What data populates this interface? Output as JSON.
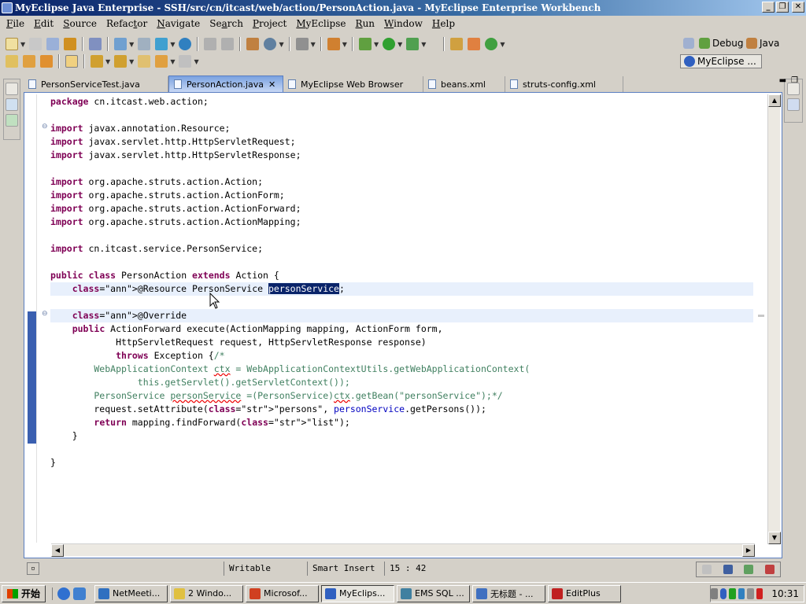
{
  "window": {
    "title": "MyEclipse Java Enterprise - SSH/src/cn/itcast/web/action/PersonAction.java - MyEclipse Enterprise Workbench"
  },
  "menu": [
    {
      "label": "File",
      "key": "F"
    },
    {
      "label": "Edit",
      "key": "E"
    },
    {
      "label": "Source",
      "key": "S"
    },
    {
      "label": "Refactor",
      "key": "t"
    },
    {
      "label": "Navigate",
      "key": "N"
    },
    {
      "label": "Search",
      "key": "a"
    },
    {
      "label": "Project",
      "key": "P"
    },
    {
      "label": "MyEclipse",
      "key": "M"
    },
    {
      "label": "Run",
      "key": "R"
    },
    {
      "label": "Window",
      "key": "W"
    },
    {
      "label": "Help",
      "key": "H"
    }
  ],
  "perspectives": {
    "debug": "Debug",
    "java": "Java",
    "myeclipse": "MyEclipse ..."
  },
  "tabs": [
    {
      "label": "PersonServiceTest.java",
      "icon": "java-file-icon"
    },
    {
      "label": "PersonAction.java",
      "icon": "java-file-icon",
      "active": true
    },
    {
      "label": "MyEclipse Web Browser",
      "icon": "globe-icon"
    },
    {
      "label": "beans.xml",
      "icon": "xml-file-icon"
    },
    {
      "label": "struts-config.xml",
      "icon": "xml-file-icon"
    }
  ],
  "code_lines": [
    "package cn.itcast.web.action;",
    "",
    "import javax.annotation.Resource;",
    "import javax.servlet.http.HttpServletRequest;",
    "import javax.servlet.http.HttpServletResponse;",
    "",
    "import org.apache.struts.action.Action;",
    "import org.apache.struts.action.ActionForm;",
    "import org.apache.struts.action.ActionForward;",
    "import org.apache.struts.action.ActionMapping;",
    "",
    "import cn.itcast.service.PersonService;",
    "",
    "public class PersonAction extends Action {",
    "    @Resource PersonService personService;",
    "",
    "    @Override",
    "    public ActionForward execute(ActionMapping mapping, ActionForm form,",
    "            HttpServletRequest request, HttpServletResponse response)",
    "            throws Exception {/*",
    "        WebApplicationContext ctx = WebApplicationContextUtils.getWebApplicationContext(",
    "                this.getServlet().getServletContext());",
    "        PersonService personService =(PersonService)ctx.getBean(\"personService\");*/",
    "        request.setAttribute(\"persons\", personService.getPersons());",
    "        return mapping.findForward(\"list\");",
    "    }",
    "",
    "}"
  ],
  "status": {
    "writable": "Writable",
    "insert_mode": "Smart Insert",
    "position": "15 : 42"
  },
  "taskbar": {
    "start": "开始",
    "tasks": [
      {
        "label": "NetMeeti...",
        "icon": "netmeeting-icon"
      },
      {
        "label": "2 Windo...",
        "icon": "folder-icon"
      },
      {
        "label": "Microsof...",
        "icon": "office-icon"
      },
      {
        "label": "MyEclips...",
        "icon": "myeclipse-icon",
        "active": true
      },
      {
        "label": "EMS SQL ...",
        "icon": "database-icon"
      },
      {
        "label": "无标题 - ...",
        "icon": "notepad-icon"
      },
      {
        "label": "EditPlus",
        "icon": "editplus-icon"
      }
    ],
    "clock": "10:31"
  }
}
